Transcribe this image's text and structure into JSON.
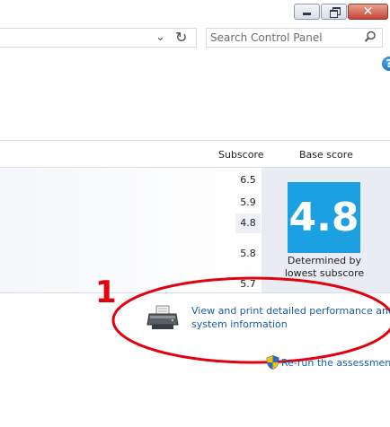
{
  "window": {
    "controls": {
      "minimize_icon": "minimize-icon",
      "maximize_icon": "restore-icon",
      "close_glyph": "✕"
    }
  },
  "navbar": {
    "search": {
      "placeholder": "Search Control Panel",
      "value": ""
    },
    "icons": [
      "chevron-down-icon",
      "refresh-icon",
      "search-icon",
      "help-icon"
    ]
  },
  "help": {
    "glyph": "?"
  },
  "table": {
    "headers": {
      "subscore": "Subscore",
      "base_score": "Base score"
    },
    "subscores": [
      "6.5",
      "5.9",
      "4.8",
      "5.8",
      "5.7"
    ],
    "base_score": "4.8",
    "base_caption_line1": "Determined by",
    "base_caption_line2": "lowest subscore",
    "tile_color": "#1ba1e2"
  },
  "annotation": {
    "number": "1",
    "color": "#e3000f"
  },
  "links": {
    "perf_line1": "View and print detailed performance and",
    "perf_line2": "system information",
    "rerun": "Re-run the assessment",
    "color": "#1a5ea8"
  }
}
